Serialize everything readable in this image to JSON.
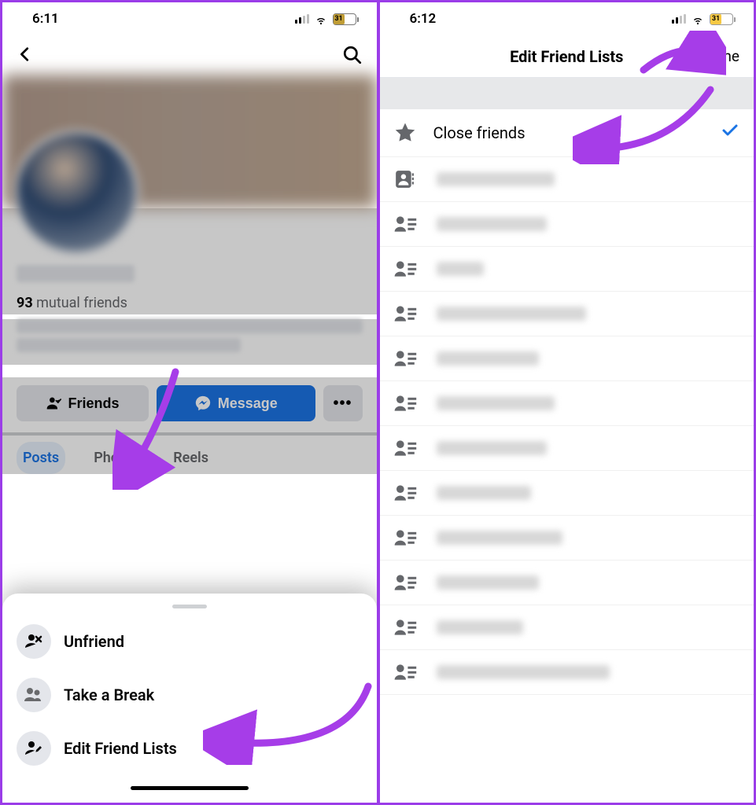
{
  "left": {
    "status": {
      "time": "6:11",
      "battery": "31"
    },
    "mutual_count": "93",
    "mutual_label": "mutual friends",
    "buttons": {
      "friends": "Friends",
      "message": "Message"
    },
    "tabs": {
      "posts": "Posts",
      "photos": "Photos",
      "reels": "Reels"
    },
    "sheet": {
      "unfriend": "Unfriend",
      "take_break": "Take a Break",
      "edit_lists": "Edit Friend Lists"
    }
  },
  "right": {
    "status": {
      "time": "6:12",
      "battery": "31"
    },
    "header": {
      "title": "Edit Friend Lists",
      "done": "Done"
    },
    "close_friends": "Close friends"
  }
}
